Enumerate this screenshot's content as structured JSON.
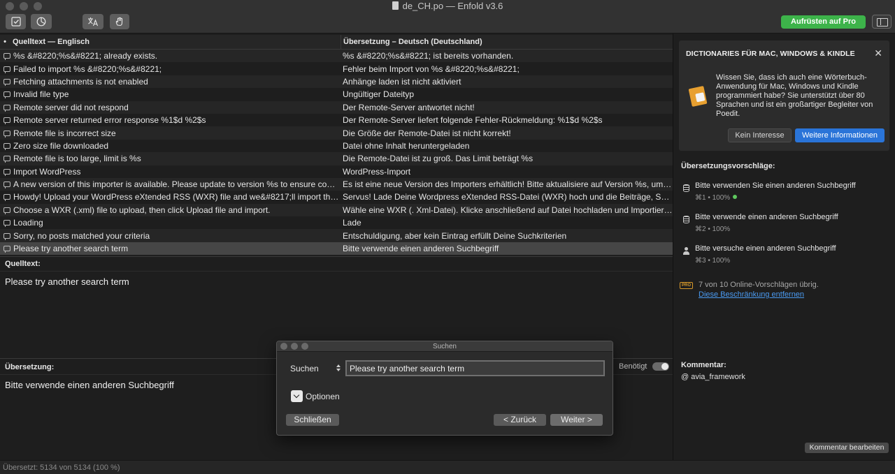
{
  "window": {
    "title": "de_CH.po — Enfold v3.6"
  },
  "toolbar": {
    "upgrade_label": "Aufrüsten auf Pro",
    "buttons": [
      "validate-icon",
      "stats-icon",
      "translate-icon",
      "hand-icon",
      "sidebar-toggle-icon"
    ]
  },
  "table": {
    "header_marker": "•",
    "col_source": "Quelltext — Englisch",
    "col_translation": "Übersetzung – Deutsch (Deutschland)",
    "rows": [
      {
        "source": "%s &#8220;%s&#8221; already exists.",
        "translation": "%s &#8220;%s&#8221; ist bereits vorhanden."
      },
      {
        "source": "Failed to import %s &#8220;%s&#8221;",
        "translation": "Fehler beim Import von %s &#8220;%s&#8221;"
      },
      {
        "source": "Fetching attachments is not enabled",
        "translation": "Anhänge laden ist nicht aktiviert"
      },
      {
        "source": "Invalid file type",
        "translation": "Ungültiger Dateityp"
      },
      {
        "source": "Remote server did not respond",
        "translation": "Der Remote-Server antwortet nicht!"
      },
      {
        "source": "Remote server returned error response %1$d %2$s",
        "translation": "Der Remote-Server liefert folgende Fehler-Rückmeldung: %1$d %2$s"
      },
      {
        "source": "Remote file is incorrect size",
        "translation": "Die Größe der Remote-Datei ist nicht korrekt!"
      },
      {
        "source": "Zero size file downloaded",
        "translation": "Datei ohne Inhalt heruntergeladen"
      },
      {
        "source": "Remote file is too large, limit is %s",
        "translation": "Die Remote-Datei ist zu groß. Das Limit beträgt %s"
      },
      {
        "source": "Import WordPress",
        "translation": "WordPress-Import"
      },
      {
        "source": "A new version of this importer is available. Please update to version %s to ensure comp...",
        "translation": "Es ist eine neue Version des Importers erhältlich! Bitte aktualisiere auf Version %s, um d..."
      },
      {
        "source": "Howdy! Upload your WordPress eXtended RSS (WXR) file and we&#8217;ll import the p...",
        "translation": "Servus! Lade Deine Wordpress eXtended RSS-Datei (WXR) hoch und die Beiträge, Seite..."
      },
      {
        "source": "Choose a WXR (.xml) file to upload, then click Upload file and import.",
        "translation": "Wähle eine WXR (. Xml-Datei). Klicke anschließend auf Datei hochladen und Importieren."
      },
      {
        "source": "Loading",
        "translation": "Lade"
      },
      {
        "source": "Sorry, no posts matched your criteria",
        "translation": "Entschuldigung, aber kein Eintrag erfüllt Deine Suchkriterien"
      },
      {
        "source": "Please try another search term",
        "translation": "Bitte verwende einen anderen Suchbegriff"
      }
    ]
  },
  "source_pane": {
    "label": "Quelltext:",
    "text": "Please try another search term"
  },
  "translation_pane": {
    "label": "Übersetzung:",
    "text": "Bitte verwende einen anderen Suchbegriff",
    "needed_label": "Benötigt"
  },
  "statusbar": {
    "text": "Übersetzt: 5134 von 5134 (100 %)"
  },
  "sidebar": {
    "promo": {
      "title": "DICTIONARIES FÜR MAC, WINDOWS & KINDLE",
      "close": "✕",
      "text": "Wissen Sie, dass ich auch eine Wörterbuch-Anwendung für Mac, Windows und Kindle programmiert habe? Sie unterstützt über 80 Sprachen und ist ein großartiger Begleiter von Poedit.",
      "no_interest": "Kein Interesse",
      "more_info": "Weitere Informationen"
    },
    "suggestions_title": "Übersetzungsvorschläge:",
    "suggestions": [
      {
        "text": "Bitte verwenden Sie einen anderen Suchbegriff",
        "meta": "⌘1 • 100%",
        "icon": "database-icon",
        "exact": true
      },
      {
        "text": "Bitte verwende einen anderen Suchbegriff",
        "meta": "⌘2 • 100%",
        "icon": "database-icon",
        "exact": false
      },
      {
        "text": "Bitte versuche einen anderen Suchbegriff",
        "meta": "⌘3 • 100%",
        "icon": "person-icon",
        "exact": false
      }
    ],
    "pro_badge": "PRO",
    "pro_remaining": "7 von 10 Online-Vorschlägen übrig.",
    "pro_link": "Diese Beschränkung entfernen",
    "comment_label": "Kommentar:",
    "comment_text": "@ avia_framework",
    "comment_edit": "Kommentar bearbeiten"
  },
  "find_dialog": {
    "title": "Suchen",
    "search_label": "Suchen",
    "search_value": "Please try another search term",
    "options_label": "Optionen",
    "close_button": "Schließen",
    "back_button": "< Zurück",
    "next_button": "Weiter >"
  },
  "colors": {
    "upgrade_green": "#3db34a",
    "link_blue": "#4a9af0",
    "primary_button_blue": "#2a74d8",
    "pro_badge_orange": "#d89a2a"
  }
}
